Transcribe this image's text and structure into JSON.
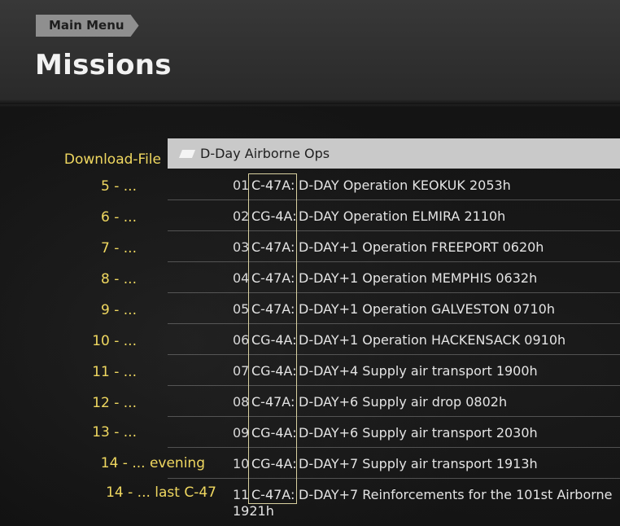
{
  "header": {
    "breadcrumb": "Main Menu",
    "title": "Missions"
  },
  "left_list": [
    "Download-File",
    "5 - ...",
    "6 - ...",
    "7 - ...",
    "8 - ...",
    "9 - ...",
    "10 - ...",
    "11 - ...",
    "12 - ...",
    "13 - ...",
    "14 - ... evening",
    "14 - ... last C-47"
  ],
  "folder": {
    "icon": "folder-icon",
    "label": "D-Day Airborne Ops"
  },
  "missions": [
    {
      "num": "01",
      "aircraft": "C-47A:",
      "desc": "D-DAY Operation KEOKUK 2053h"
    },
    {
      "num": "02",
      "aircraft": "CG-4A:",
      "desc": "D-DAY Operation ELMIRA 2110h"
    },
    {
      "num": "03",
      "aircraft": "C-47A:",
      "desc": "D-DAY+1 Operation FREEPORT 0620h"
    },
    {
      "num": "04",
      "aircraft": "C-47A:",
      "desc": "D-DAY+1 Operation MEMPHIS 0632h"
    },
    {
      "num": "05",
      "aircraft": "C-47A:",
      "desc": "D-DAY+1 Operation GALVESTON 0710h"
    },
    {
      "num": "06",
      "aircraft": "CG-4A:",
      "desc": "D-DAY+1 Operation HACKENSACK 0910h"
    },
    {
      "num": "07",
      "aircraft": "CG-4A:",
      "desc": "D-DAY+4 Supply air transport 1900h"
    },
    {
      "num": "08",
      "aircraft": "C-47A:",
      "desc": "D-DAY+6 Supply air drop 0802h"
    },
    {
      "num": "09",
      "aircraft": "CG-4A:",
      "desc": "D-DAY+6 Supply air transport 2030h"
    },
    {
      "num": "10",
      "aircraft": "CG-4A:",
      "desc": "D-DAY+7 Supply air transport 1913h"
    },
    {
      "num": "11",
      "aircraft": "C-47A:",
      "desc": "D-DAY+7 Reinforcements for the 101st Airborne 1921h"
    }
  ],
  "colors": {
    "accent_yellow": "#f0d860",
    "folder_bar": "#c9c9c9"
  }
}
